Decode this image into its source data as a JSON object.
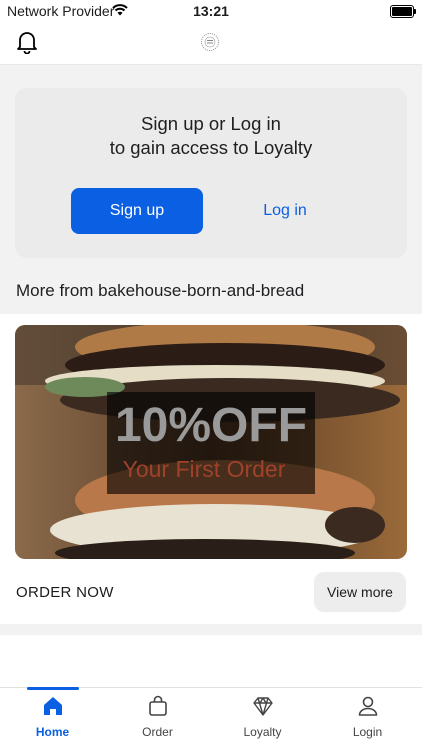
{
  "status_bar": {
    "carrier": "Network Provider",
    "time": "13:21"
  },
  "card": {
    "line1": "Sign up or Log in",
    "line2": "to gain access to Loyalty",
    "signup": "Sign up",
    "login": "Log in"
  },
  "more_section": {
    "title": "More from bakehouse-born-and-bread"
  },
  "promo": {
    "image_line1": "10%OFF",
    "image_line2": "Your First Order",
    "order_now": "ORDER NOW",
    "view_more": "View more"
  },
  "tabs": [
    {
      "label": "Home",
      "icon": "home-icon"
    },
    {
      "label": "Order",
      "icon": "bag-icon"
    },
    {
      "label": "Loyalty",
      "icon": "diamond-icon"
    },
    {
      "label": "Login",
      "icon": "person-icon"
    }
  ],
  "colors": {
    "accent": "#0a5fe3",
    "card_bg": "#ebebeb",
    "page_bg": "#f2f2f2"
  }
}
